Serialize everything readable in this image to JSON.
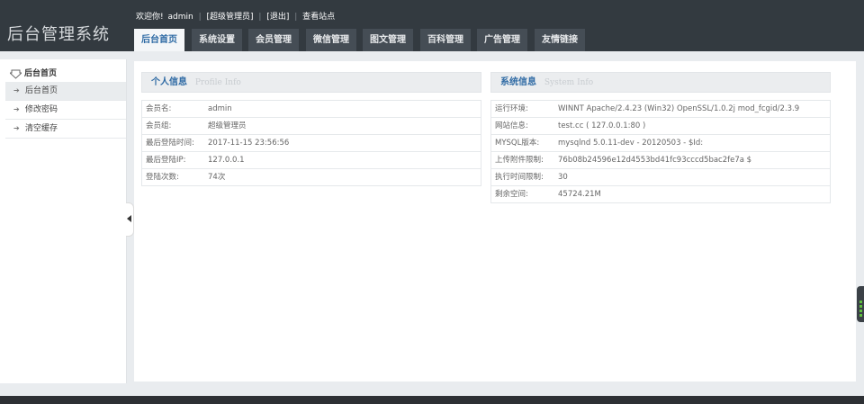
{
  "app": {
    "title": "后台管理系统"
  },
  "topbar": {
    "welcome": "欢迎你!",
    "username": "admin",
    "role": "[超级管理员]",
    "logout": "[退出]",
    "view_site": "查看站点"
  },
  "tabs": [
    {
      "label": "后台首页",
      "active": true
    },
    {
      "label": "系统设置"
    },
    {
      "label": "会员管理"
    },
    {
      "label": "微信管理"
    },
    {
      "label": "图文管理"
    },
    {
      "label": "百科管理"
    },
    {
      "label": "广告管理"
    },
    {
      "label": "友情链接"
    }
  ],
  "sidebar": {
    "heading": "后台首页",
    "items": [
      {
        "label": "后台首页",
        "active": true
      },
      {
        "label": "修改密码"
      },
      {
        "label": "清空缓存"
      }
    ]
  },
  "profile": {
    "title": "个人信息",
    "subtitle": "Profile  Info",
    "rows": [
      {
        "key": "会员名:",
        "value": "admin"
      },
      {
        "key": "会员组:",
        "value": "超级管理员"
      },
      {
        "key": "最后登陆时间:",
        "value": "2017-11-15 23:56:56"
      },
      {
        "key": "最后登陆IP:",
        "value": "127.0.0.1"
      },
      {
        "key": "登陆次数:",
        "value": "74次"
      }
    ]
  },
  "system": {
    "title": "系统信息",
    "subtitle": "System  Info",
    "rows": [
      {
        "key": "运行环境:",
        "value": "WINNT Apache/2.4.23 (Win32) OpenSSL/1.0.2j mod_fcgid/2.3.9"
      },
      {
        "key": "网站信息:",
        "value": "test.cc ( 127.0.0.1:80 )"
      },
      {
        "key": "MYSQL版本:",
        "value": "mysqlnd 5.0.11-dev - 20120503 - $Id:"
      },
      {
        "key": "上传附件限制:",
        "value": "76b08b24596e12d4553bd41fc93cccd5bac2fe7a $"
      },
      {
        "key": "执行时间限制:",
        "value": "30"
      },
      {
        "key": "剩余空间:",
        "value": "45724.21M"
      }
    ]
  }
}
